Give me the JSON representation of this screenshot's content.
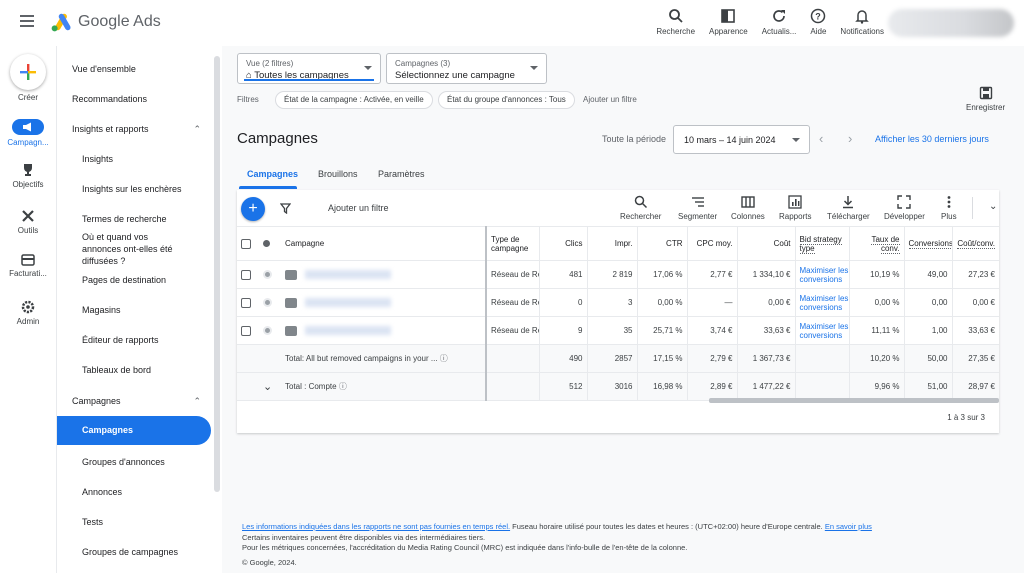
{
  "app": {
    "name": "Google Ads"
  },
  "topbar": {
    "actions": [
      {
        "label": "Recherche",
        "icon": "search-icon"
      },
      {
        "label": "Apparence",
        "icon": "appearance-icon"
      },
      {
        "label": "Actualis...",
        "icon": "refresh-icon"
      },
      {
        "label": "Aide",
        "icon": "help-icon"
      },
      {
        "label": "Notifications",
        "icon": "bell-icon"
      }
    ]
  },
  "rail": {
    "create": "Créer",
    "campaigns": "Campagn...",
    "goals": "Objectifs",
    "tools": "Outils",
    "billing": "Facturati...",
    "admin": "Admin"
  },
  "nav": {
    "overview": "Vue d'ensemble",
    "recommendations": "Recommandations",
    "insights_reports": "Insights et rapports",
    "insights": "Insights",
    "auction_insights": "Insights sur les enchères",
    "search_terms": "Termes de recherche",
    "where_ads_shown": "Où et quand vos annonces ont-elles été diffusées ?",
    "landing_pages": "Pages de destination",
    "stores": "Magasins",
    "report_editor": "Éditeur de rapports",
    "dashboards": "Tableaux de bord",
    "campaigns_group": "Campagnes",
    "campaigns": "Campagnes",
    "ad_groups": "Groupes d'annonces",
    "ads": "Annonces",
    "tests": "Tests",
    "campaign_groups": "Groupes de campagnes"
  },
  "filters": {
    "view_small": "Vue (2 filtres)",
    "view_value": "Toutes les campagnes",
    "campaign_small": "Campagnes (3)",
    "campaign_value": "Sélectionnez une campagne",
    "label": "Filtres",
    "chip1": "État de la campagne : Activée, en veille",
    "chip2": "État du groupe d'annonces : Tous",
    "add": "Ajouter un filtre",
    "save": "Enregistrer"
  },
  "page": {
    "title": "Campagnes",
    "period_label": "Toute la période",
    "date_range": "10 mars – 14 juin 2024",
    "last30": "Afficher les 30 derniers jours",
    "tabs": [
      "Campagnes",
      "Brouillons",
      "Paramètres"
    ]
  },
  "toolbar": {
    "add_filter": "Ajouter un filtre",
    "buttons": [
      "Rechercher",
      "Segmenter",
      "Colonnes",
      "Rapports",
      "Télécharger",
      "Développer",
      "Plus"
    ]
  },
  "table": {
    "headers": {
      "campaign": "Campagne",
      "type": "Type de campagne",
      "clicks": "Clics",
      "impr": "Impr.",
      "ctr": "CTR",
      "cpc": "CPC moy.",
      "cost": "Coût",
      "bid": "Bid strategy type",
      "conv_rate": "Taux de conv.",
      "conversions": "Conversions",
      "cost_conv": "Coût/conv."
    },
    "rows": [
      {
        "type": "Réseau de Recherche",
        "clicks": "481",
        "impr": "2 819",
        "ctr": "17,06 %",
        "cpc": "2,77 €",
        "cost": "1 334,10 €",
        "bid1": "Maximiser les",
        "bid2": "conversions",
        "conv_rate": "10,19 %",
        "conversions": "49,00",
        "cost_conv": "27,23 €"
      },
      {
        "type": "Réseau de Recherche",
        "clicks": "0",
        "impr": "3",
        "ctr": "0,00 %",
        "cpc": "—",
        "cost": "0,00 €",
        "bid1": "Maximiser les",
        "bid2": "conversions",
        "conv_rate": "0,00 %",
        "conversions": "0,00",
        "cost_conv": "0,00 €"
      },
      {
        "type": "Réseau de Recherche",
        "clicks": "9",
        "impr": "35",
        "ctr": "25,71 %",
        "cpc": "3,74 €",
        "cost": "33,63 €",
        "bid1": "Maximiser les",
        "bid2": "conversions",
        "conv_rate": "11,11 %",
        "conversions": "1,00",
        "cost_conv": "33,63 €"
      }
    ],
    "total1": {
      "label": "Total: All but removed campaigns in your ...",
      "clicks": "490",
      "impr": "2857",
      "ctr": "17,15 %",
      "cpc": "2,79 €",
      "cost": "1 367,73 €",
      "conv_rate": "10,20 %",
      "conversions": "50,00",
      "cost_conv": "27,35 €"
    },
    "total2": {
      "label": "Total : Compte",
      "clicks": "512",
      "impr": "3016",
      "ctr": "16,98 %",
      "cpc": "2,89 €",
      "cost": "1 477,22 €",
      "conv_rate": "9,96 %",
      "conversions": "51,00",
      "cost_conv": "28,97 €"
    },
    "pagination": "1 à 3 sur 3"
  },
  "footer": {
    "line1_link": "Les informations indiquées dans les rapports ne sont pas fournies en temps réel.",
    "line1_text": " Fuseau horaire utilisé pour toutes les dates et heures : (UTC+02:00) heure d'Europe centrale. ",
    "line1_link2": "En savoir plus",
    "line2": "Certains inventaires peuvent être disponibles via des intermédiaires tiers.",
    "line3": "Pour les métriques concernées, l'accréditation du Media Rating Council (MRC) est indiquée dans l'info-bulle de l'en-tête de la colonne.",
    "copyright": "© Google, 2024."
  },
  "colors": {
    "accent": "#1a73e8",
    "text": "#202124",
    "muted": "#5f6368"
  }
}
